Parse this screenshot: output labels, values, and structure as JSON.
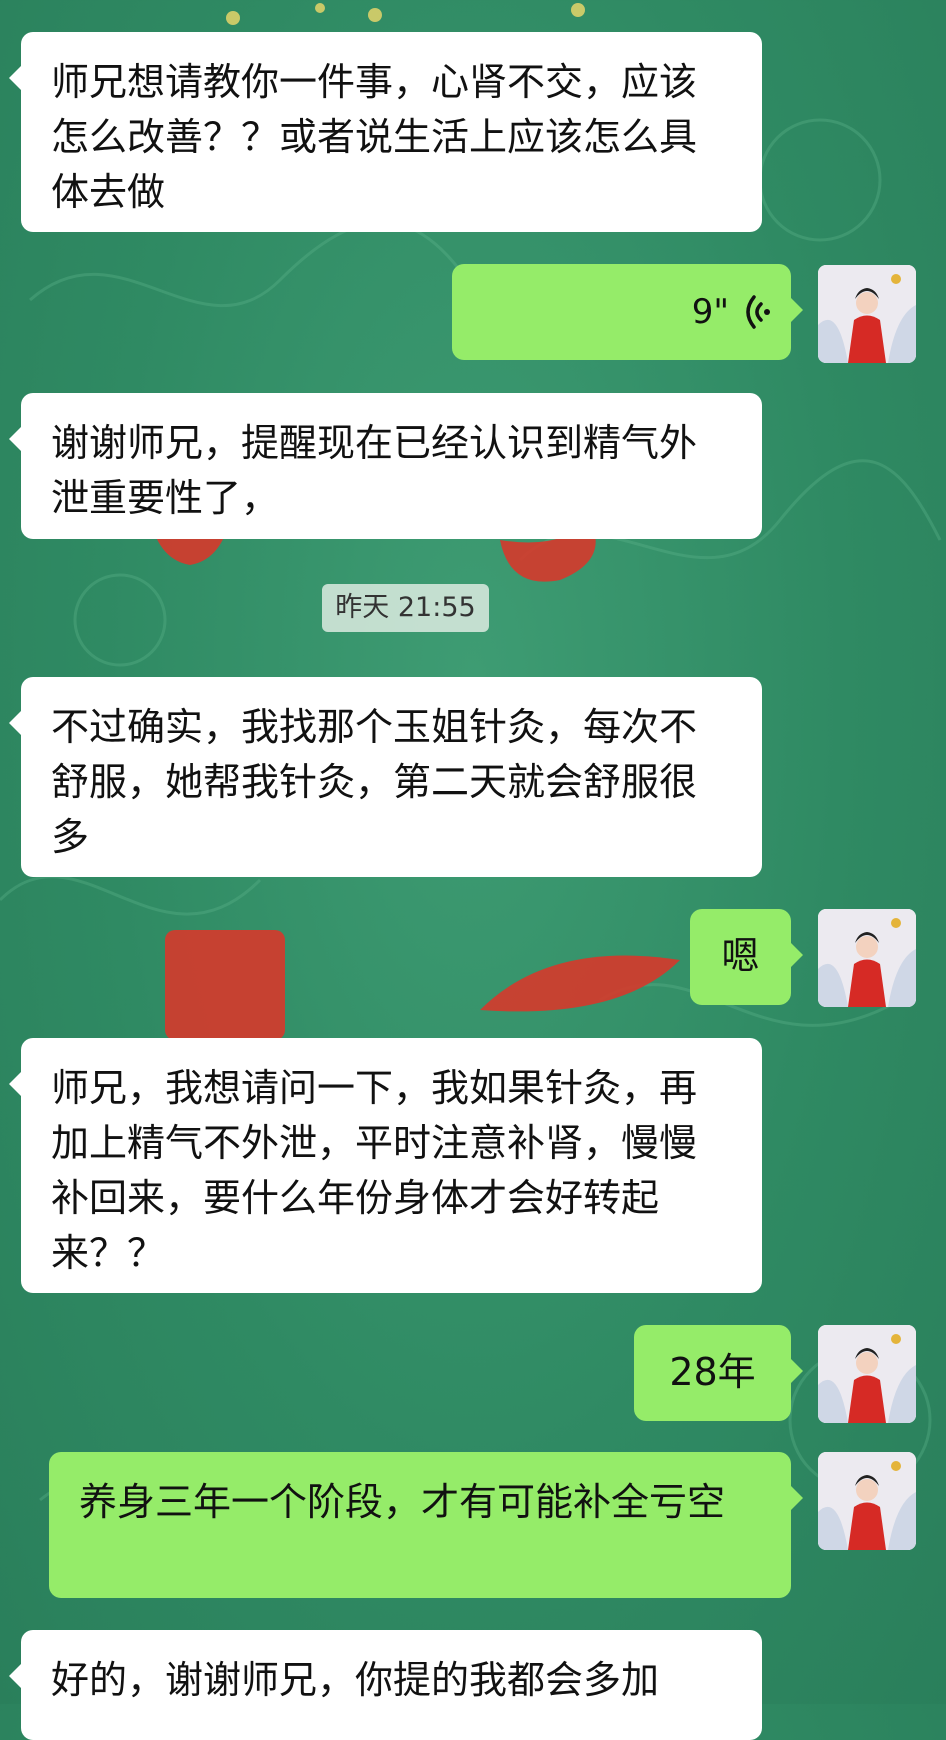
{
  "messages": [
    {
      "side": "in",
      "text": "师兄想请教你一件事，心肾不交，应该怎么改善？？或者说生活上应该怎么具体去做"
    },
    {
      "side": "out",
      "type": "voice",
      "duration": "9\""
    },
    {
      "side": "in",
      "text": "谢谢师兄，提醒现在已经认识到精气外泄重要性了，"
    },
    {
      "side": "in",
      "text": "不过确实，我找那个玉姐针灸，每次不舒服，她帮我针灸，第二天就会舒服很多"
    },
    {
      "side": "out",
      "text": "嗯"
    },
    {
      "side": "in",
      "text": "师兄，我想请问一下，我如果针灸，再加上精气不外泄，平时注意补肾，慢慢补回来，要什么年份身体才会好转起来？？"
    },
    {
      "side": "out",
      "text": "28年"
    },
    {
      "side": "out",
      "text": "养身三年一个阶段，才有可能补全亏空"
    },
    {
      "side": "in",
      "text": "好的，谢谢师兄，你提的我都会多加"
    }
  ],
  "timestamp": "昨天 21:55",
  "colors": {
    "incoming": "#ffffff",
    "outgoing": "#95ec69",
    "background": "#2f8a63"
  },
  "icons": {
    "voice": "voice-wave-icon"
  }
}
